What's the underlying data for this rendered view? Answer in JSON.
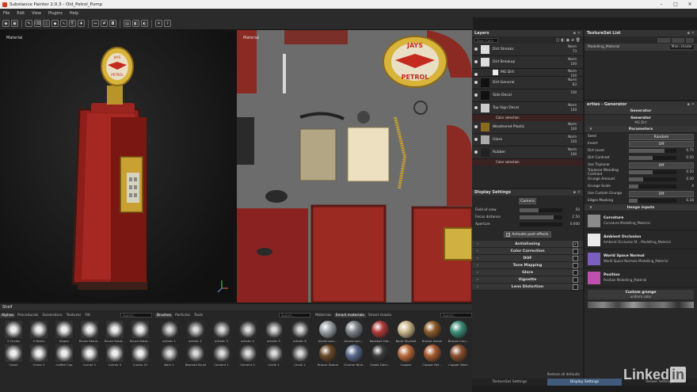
{
  "window": {
    "title": "Substance Painter 2.0.3 - Old_Petrol_Pump"
  },
  "menu": [
    "File",
    "Edit",
    "View",
    "Plugins",
    "Help"
  ],
  "viewport3d": {
    "label": "Material"
  },
  "viewport2d": {
    "label": "Material",
    "sign_top": "JAYS",
    "sign_bottom": "PETROL"
  },
  "pump_sign": {
    "top": "JAYS",
    "bottom": "PETROL"
  },
  "layers": {
    "title": "Layers",
    "channel": "Base Color",
    "rows": [
      {
        "name": "Dirt Streaks",
        "blend": "Norm",
        "opacity": "73"
      },
      {
        "name": "Dirt Breakup",
        "blend": "Norm",
        "opacity": "100"
      },
      {
        "name": "MG Dirt",
        "blend": "Norm",
        "opacity": "100"
      },
      {
        "name": "Dirt General",
        "blend": "Norm",
        "opacity": "83"
      },
      {
        "name": "Side Decal",
        "blend": "",
        "opacity": "100"
      },
      {
        "name": "Top Sign Decal",
        "blend": "Norm",
        "opacity": "100"
      },
      {
        "name": "Weathered Plastic",
        "blend": "Norm",
        "opacity": "100"
      },
      {
        "name": "Glass",
        "blend": "Norm",
        "opacity": "100"
      },
      {
        "name": "Rubber",
        "blend": "Norm",
        "opacity": "100"
      }
    ],
    "color_selection": "Color selection"
  },
  "display": {
    "title": "Display Settings",
    "camera": "Camera",
    "fov": {
      "label": "Field of view",
      "value": "50",
      "frac": 0.45
    },
    "focus": {
      "label": "Focus distance",
      "value": "2.50",
      "frac": 0.8
    },
    "aperture": {
      "label": "Aperture",
      "value": "0.000",
      "frac": 0.0
    },
    "post_effects": "Activate post effects",
    "sections": [
      "Antialiasing",
      "Color Correction",
      "DOF",
      "Tone Mapping",
      "Glare",
      "Vignette",
      "Lens Distortion"
    ],
    "restore": "Restore all defaults"
  },
  "textureset": {
    "title": "TextureSet List",
    "item": "Modelling_Material",
    "shader": "Main shader"
  },
  "properties": {
    "title": "erties - Generator",
    "section": "Generator",
    "generator_btn": "Generator",
    "generator_name": "MG Dirt",
    "parameters": "Parameters",
    "params": [
      {
        "label": "Seed",
        "value": "Random",
        "type": "button"
      },
      {
        "label": "Invert",
        "value": "Off",
        "type": "button"
      },
      {
        "label": "Dirt Level",
        "value": "0.75",
        "frac": 0.75,
        "type": "slider"
      },
      {
        "label": "Dirt Contrast",
        "value": "0.50",
        "frac": 0.5,
        "type": "slider"
      },
      {
        "label": "Use Triplanar",
        "value": "Off",
        "type": "button"
      },
      {
        "label": "Triplanar Blending Contrast",
        "value": "0.50",
        "frac": 0.5,
        "type": "slider"
      },
      {
        "label": "Grunge Amount",
        "value": "0.30",
        "frac": 0.3,
        "type": "slider"
      },
      {
        "label": "Grunge Scale",
        "value": "4",
        "frac": 0.2,
        "type": "slider"
      },
      {
        "label": "Use Custom Grunge",
        "value": "Off",
        "type": "button"
      },
      {
        "label": "Edges Masking",
        "value": "0.18",
        "frac": 0.18,
        "type": "slider"
      }
    ],
    "image_inputs": "Image inputs",
    "inputs": [
      {
        "title": "Curvature",
        "sub": "Curvature Modelling_Material",
        "color": "#8a8a8a"
      },
      {
        "title": "Ambient Occlusion",
        "sub": "Ambient Occlusion M... Modelling_Material",
        "color": "#eaeaea"
      },
      {
        "title": "World Space Normal",
        "sub": "World Space Normals Modelling_Material",
        "color": "#7a5fc0"
      },
      {
        "title": "Position",
        "sub": "Position Modelling_Material",
        "color": "#c050b0"
      }
    ],
    "custom_grunge": "Custom grunge",
    "uniform": "uniform color"
  },
  "bottom_tabs": [
    "TextureSet Settings",
    "Display Settings",
    "Viewer Settings"
  ],
  "shelf": {
    "title": "Shelf",
    "tabs": [
      "Alphas",
      "Procedurals",
      "Generators",
      "Textures",
      "Filt"
    ],
    "alphas": [
      "3 Circles",
      "4 Marks",
      "Zipper",
      "Brush Stone...",
      "Brush Rotat...",
      "Brush Rotat...",
      "Claws",
      "Claws 2",
      "Coffee Cup",
      "Corner 1",
      "Corner 2",
      "Cracks 01"
    ],
    "brush_tabs": [
      "Brushes",
      "Particles",
      "Tools"
    ],
    "brushes": [
      "artistic 1",
      "artistic 2",
      "artistic 3",
      "artistic 4",
      "artistic 5",
      "artistic 6",
      "Bark 1",
      "Basmati Brush",
      "Cement 1",
      "Cement 2",
      "Chalk 1",
      "Chalk 2"
    ],
    "mat_tabs": [
      "Materials",
      "Smart materials",
      "Smart masks"
    ],
    "materials": [
      {
        "name": "Aluminium...",
        "color": "#9aa0a6"
      },
      {
        "name": "Aluminium...",
        "color": "#7d838a"
      },
      {
        "name": "Baseball Hat...",
        "color": "#b03a3a"
      },
      {
        "name": "Bone Stylized",
        "color": "#cbb78b"
      },
      {
        "name": "Bronze Armor",
        "color": "#8a5a2a"
      },
      {
        "name": "Bronze Corr...",
        "color": "#3f8f7a"
      },
      {
        "name": "Bronze Statue",
        "color": "#6b4a2a"
      },
      {
        "name": "Chrome Blue...",
        "color": "#5a6a8a"
      },
      {
        "name": "Cobalt Dam...",
        "color": "#3a3a3a"
      },
      {
        "name": "Copper",
        "color": "#b86a3a"
      },
      {
        "name": "Copper Rel...",
        "color": "#a55a30"
      },
      {
        "name": "Copper Worn",
        "color": "#8a5030"
      }
    ],
    "search": "Search..."
  },
  "watermark": "Linked"
}
